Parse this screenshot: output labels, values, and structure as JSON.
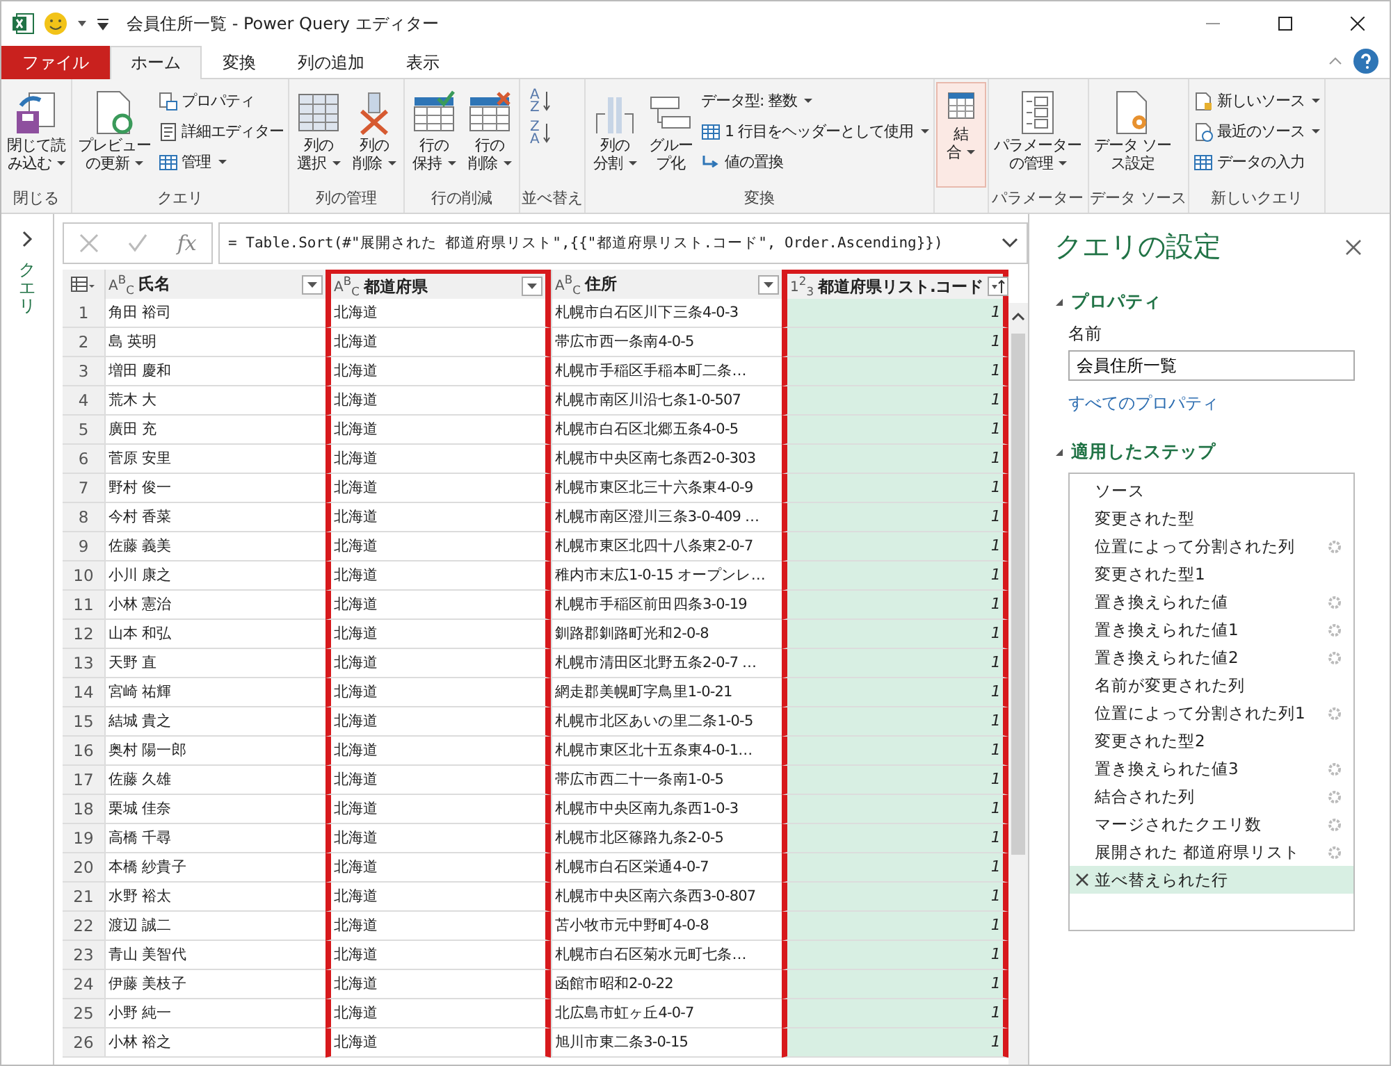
{
  "window": {
    "title": "会員住所一覧 - Power Query エディター"
  },
  "tabs": [
    {
      "label": "ファイル",
      "kind": "file",
      "selected": false
    },
    {
      "label": "ホーム",
      "kind": "tab",
      "selected": true
    },
    {
      "label": "変換",
      "kind": "tab",
      "selected": false
    },
    {
      "label": "列の追加",
      "kind": "tab",
      "selected": false
    },
    {
      "label": "表示",
      "kind": "tab",
      "selected": false
    }
  ],
  "ribbon": {
    "groups": [
      {
        "label": "閉じる",
        "items": [
          {
            "kind": "large",
            "lines": [
              "閉じて読",
              "み込む"
            ],
            "dropdown": true,
            "highlighted": false
          }
        ]
      },
      {
        "label": "クエリ",
        "items": [
          {
            "kind": "large",
            "lines": [
              "プレビュー",
              "の更新"
            ],
            "dropdown": true,
            "highlighted": false
          },
          {
            "kind": "stack",
            "buttons": [
              {
                "label": "プロパティ",
                "dropdown": false
              },
              {
                "label": "詳細エディター",
                "dropdown": false
              },
              {
                "label": "管理",
                "dropdown": true
              }
            ]
          }
        ]
      },
      {
        "label": "列の管理",
        "items": [
          {
            "kind": "large",
            "lines": [
              "列の",
              "選択"
            ],
            "dropdown": true,
            "highlighted": false
          },
          {
            "kind": "large",
            "lines": [
              "列の",
              "削除"
            ],
            "dropdown": true,
            "highlighted": false
          }
        ]
      },
      {
        "label": "行の削減",
        "items": [
          {
            "kind": "large",
            "lines": [
              "行の",
              "保持"
            ],
            "dropdown": true,
            "highlighted": false
          },
          {
            "kind": "large",
            "lines": [
              "行の",
              "削除"
            ],
            "dropdown": true,
            "highlighted": false
          }
        ]
      },
      {
        "label": "並べ替え",
        "items": [
          {
            "kind": "sort",
            "buttons": [
              {
                "top": "A",
                "bottom": "Z"
              },
              {
                "top": "Z",
                "bottom": "A"
              }
            ]
          }
        ]
      },
      {
        "label": "変換",
        "items": [
          {
            "kind": "large",
            "lines": [
              "列の",
              "分割"
            ],
            "dropdown": true,
            "highlighted": false
          },
          {
            "kind": "large",
            "lines": [
              "グルー",
              "プ化"
            ],
            "dropdown": false,
            "highlighted": false
          },
          {
            "kind": "stack",
            "buttons": [
              {
                "label": "データ型: 整数",
                "dropdown": true
              },
              {
                "label": "1 行目をヘッダーとして使用",
                "dropdown": true
              },
              {
                "label": "値の置換",
                "dropdown": false
              }
            ]
          }
        ]
      },
      {
        "items": [
          {
            "kind": "large",
            "lines": [
              "結",
              "合"
            ],
            "dropdown": true,
            "highlighted": true
          }
        ]
      },
      {
        "label": "パラメーター",
        "items": [
          {
            "kind": "large",
            "lines": [
              "パラメーター",
              "の管理"
            ],
            "dropdown": true,
            "highlighted": false
          }
        ]
      },
      {
        "label": "データ ソース",
        "items": [
          {
            "kind": "large",
            "lines": [
              "データ ソー",
              "ス設定"
            ],
            "dropdown": false,
            "highlighted": false
          }
        ]
      },
      {
        "label": "新しいクエリ",
        "items": [
          {
            "kind": "stack",
            "buttons": [
              {
                "label": "新しいソース",
                "dropdown": true
              },
              {
                "label": "最近のソース",
                "dropdown": true
              },
              {
                "label": "データの入力",
                "dropdown": false
              }
            ]
          }
        ]
      }
    ]
  },
  "queries_pane": {
    "label": "クエリ"
  },
  "formula_bar": {
    "fx": "fx",
    "formula": "= Table.Sort(#\"展開された 都道府県リスト\",{{\"都道府県リスト.コード\", Order.Ascending}})"
  },
  "table": {
    "columns": [
      {
        "type": "A$^{B}$$_{C}$",
        "name": "氏名",
        "highlighted": false,
        "selected": false,
        "sorted": false
      },
      {
        "type": "A$^{B}$$_{C}$",
        "name": "都道府県",
        "highlighted": true,
        "selected": false,
        "sorted": false
      },
      {
        "type": "A$^{B}$$_{C}$",
        "name": "住所",
        "highlighted": false,
        "selected": false,
        "sorted": false
      },
      {
        "type": "1$^{2}$$_{3}$",
        "name": "都道府県リスト.コード",
        "highlighted": true,
        "selected": true,
        "sorted": true
      }
    ],
    "rows": [
      {
        "number": "1",
        "cells": [
          "角田 裕司",
          "北海道",
          "札幌市白石区川下三条4-0-3",
          "1"
        ]
      },
      {
        "number": "2",
        "cells": [
          "島 英明",
          "北海道",
          "帯広市西一条南4-0-5",
          "1"
        ]
      },
      {
        "number": "3",
        "cells": [
          "増田 慶和",
          "北海道",
          "札幌市手稲区手稲本町二条…",
          "1"
        ]
      },
      {
        "number": "4",
        "cells": [
          "荒木 大",
          "北海道",
          "札幌市南区川沿七条1-0-507",
          "1"
        ]
      },
      {
        "number": "5",
        "cells": [
          "廣田 充",
          "北海道",
          "札幌市白石区北郷五条4-0-5",
          "1"
        ]
      },
      {
        "number": "6",
        "cells": [
          "菅原 安里",
          "北海道",
          "札幌市中央区南七条西2-0-303",
          "1"
        ]
      },
      {
        "number": "7",
        "cells": [
          "野村 俊一",
          "北海道",
          "札幌市東区北三十六条東4-0-9",
          "1"
        ]
      },
      {
        "number": "8",
        "cells": [
          "今村 香菜",
          "北海道",
          "札幌市南区澄川三条3-0-409 …",
          "1"
        ]
      },
      {
        "number": "9",
        "cells": [
          "佐藤 義美",
          "北海道",
          "札幌市東区北四十八条東2-0-7",
          "1"
        ]
      },
      {
        "number": "10",
        "cells": [
          "小川 康之",
          "北海道",
          "稚内市末広1-0-15 オープンレ…",
          "1"
        ]
      },
      {
        "number": "11",
        "cells": [
          "小林 憲治",
          "北海道",
          "札幌市手稲区前田四条3-0-19",
          "1"
        ]
      },
      {
        "number": "12",
        "cells": [
          "山本 和弘",
          "北海道",
          "釧路郡釧路町光和2-0-8",
          "1"
        ]
      },
      {
        "number": "13",
        "cells": [
          "天野 直",
          "北海道",
          "札幌市清田区北野五条2-0-7 …",
          "1"
        ]
      },
      {
        "number": "14",
        "cells": [
          "宮崎 祐輝",
          "北海道",
          "網走郡美幌町字鳥里1-0-21",
          "1"
        ]
      },
      {
        "number": "15",
        "cells": [
          "結城 貴之",
          "北海道",
          "札幌市北区あいの里二条1-0-5",
          "1"
        ]
      },
      {
        "number": "16",
        "cells": [
          "奥村 陽一郎",
          "北海道",
          "札幌市東区北十五条東4-0-1…",
          "1"
        ]
      },
      {
        "number": "17",
        "cells": [
          "佐藤 久雄",
          "北海道",
          "帯広市西二十一条南1-0-5",
          "1"
        ]
      },
      {
        "number": "18",
        "cells": [
          "栗城 佳奈",
          "北海道",
          "札幌市中央区南九条西1-0-3",
          "1"
        ]
      },
      {
        "number": "19",
        "cells": [
          "高橋 千尋",
          "北海道",
          "札幌市北区篠路九条2-0-5",
          "1"
        ]
      },
      {
        "number": "20",
        "cells": [
          "本橋 紗貴子",
          "北海道",
          "札幌市白石区栄通4-0-7",
          "1"
        ]
      },
      {
        "number": "21",
        "cells": [
          "水野 裕太",
          "北海道",
          "札幌市中央区南六条西3-0-807",
          "1"
        ]
      },
      {
        "number": "22",
        "cells": [
          "渡辺 誠二",
          "北海道",
          "苫小牧市元中野町4-0-8",
          "1"
        ]
      },
      {
        "number": "23",
        "cells": [
          "青山 美智代",
          "北海道",
          "札幌市白石区菊水元町七条…",
          "1"
        ]
      },
      {
        "number": "24",
        "cells": [
          "伊藤 美枝子",
          "北海道",
          "函館市昭和2-0-22",
          "1"
        ]
      },
      {
        "number": "25",
        "cells": [
          "小野 純一",
          "北海道",
          "北広島市虹ヶ丘4-0-7",
          "1"
        ]
      },
      {
        "number": "26",
        "cells": [
          "小林 裕之",
          "北海道",
          "旭川市東二条3-0-15",
          "1"
        ]
      }
    ]
  },
  "settings": {
    "title": "クエリの設定",
    "properties": {
      "heading": "プロパティ",
      "expanded": true,
      "name_label": "名前",
      "name_value": "会員住所一覧",
      "all_link": "すべてのプロパティ"
    },
    "steps": {
      "heading": "適用したステップ",
      "expanded": true,
      "items": [
        {
          "label": "ソース",
          "settings": false,
          "selected": false
        },
        {
          "label": "変更された型",
          "settings": false,
          "selected": false
        },
        {
          "label": "位置によって分割された列",
          "settings": true,
          "selected": false
        },
        {
          "label": "変更された型1",
          "settings": false,
          "selected": false
        },
        {
          "label": "置き換えられた値",
          "settings": true,
          "selected": false
        },
        {
          "label": "置き換えられた値1",
          "settings": true,
          "selected": false
        },
        {
          "label": "置き換えられた値2",
          "settings": true,
          "selected": false
        },
        {
          "label": "名前が変更された列",
          "settings": false,
          "selected": false
        },
        {
          "label": "位置によって分割された列1",
          "settings": true,
          "selected": false
        },
        {
          "label": "変更された型2",
          "settings": false,
          "selected": false
        },
        {
          "label": "置き換えられた値3",
          "settings": true,
          "selected": false
        },
        {
          "label": "結合された列",
          "settings": true,
          "selected": false
        },
        {
          "label": "マージされたクエリ数",
          "settings": true,
          "selected": false
        },
        {
          "label": "展開された 都道府県リスト",
          "settings": true,
          "selected": false
        },
        {
          "label": "並べ替えられた行",
          "settings": false,
          "selected": true
        }
      ]
    }
  }
}
